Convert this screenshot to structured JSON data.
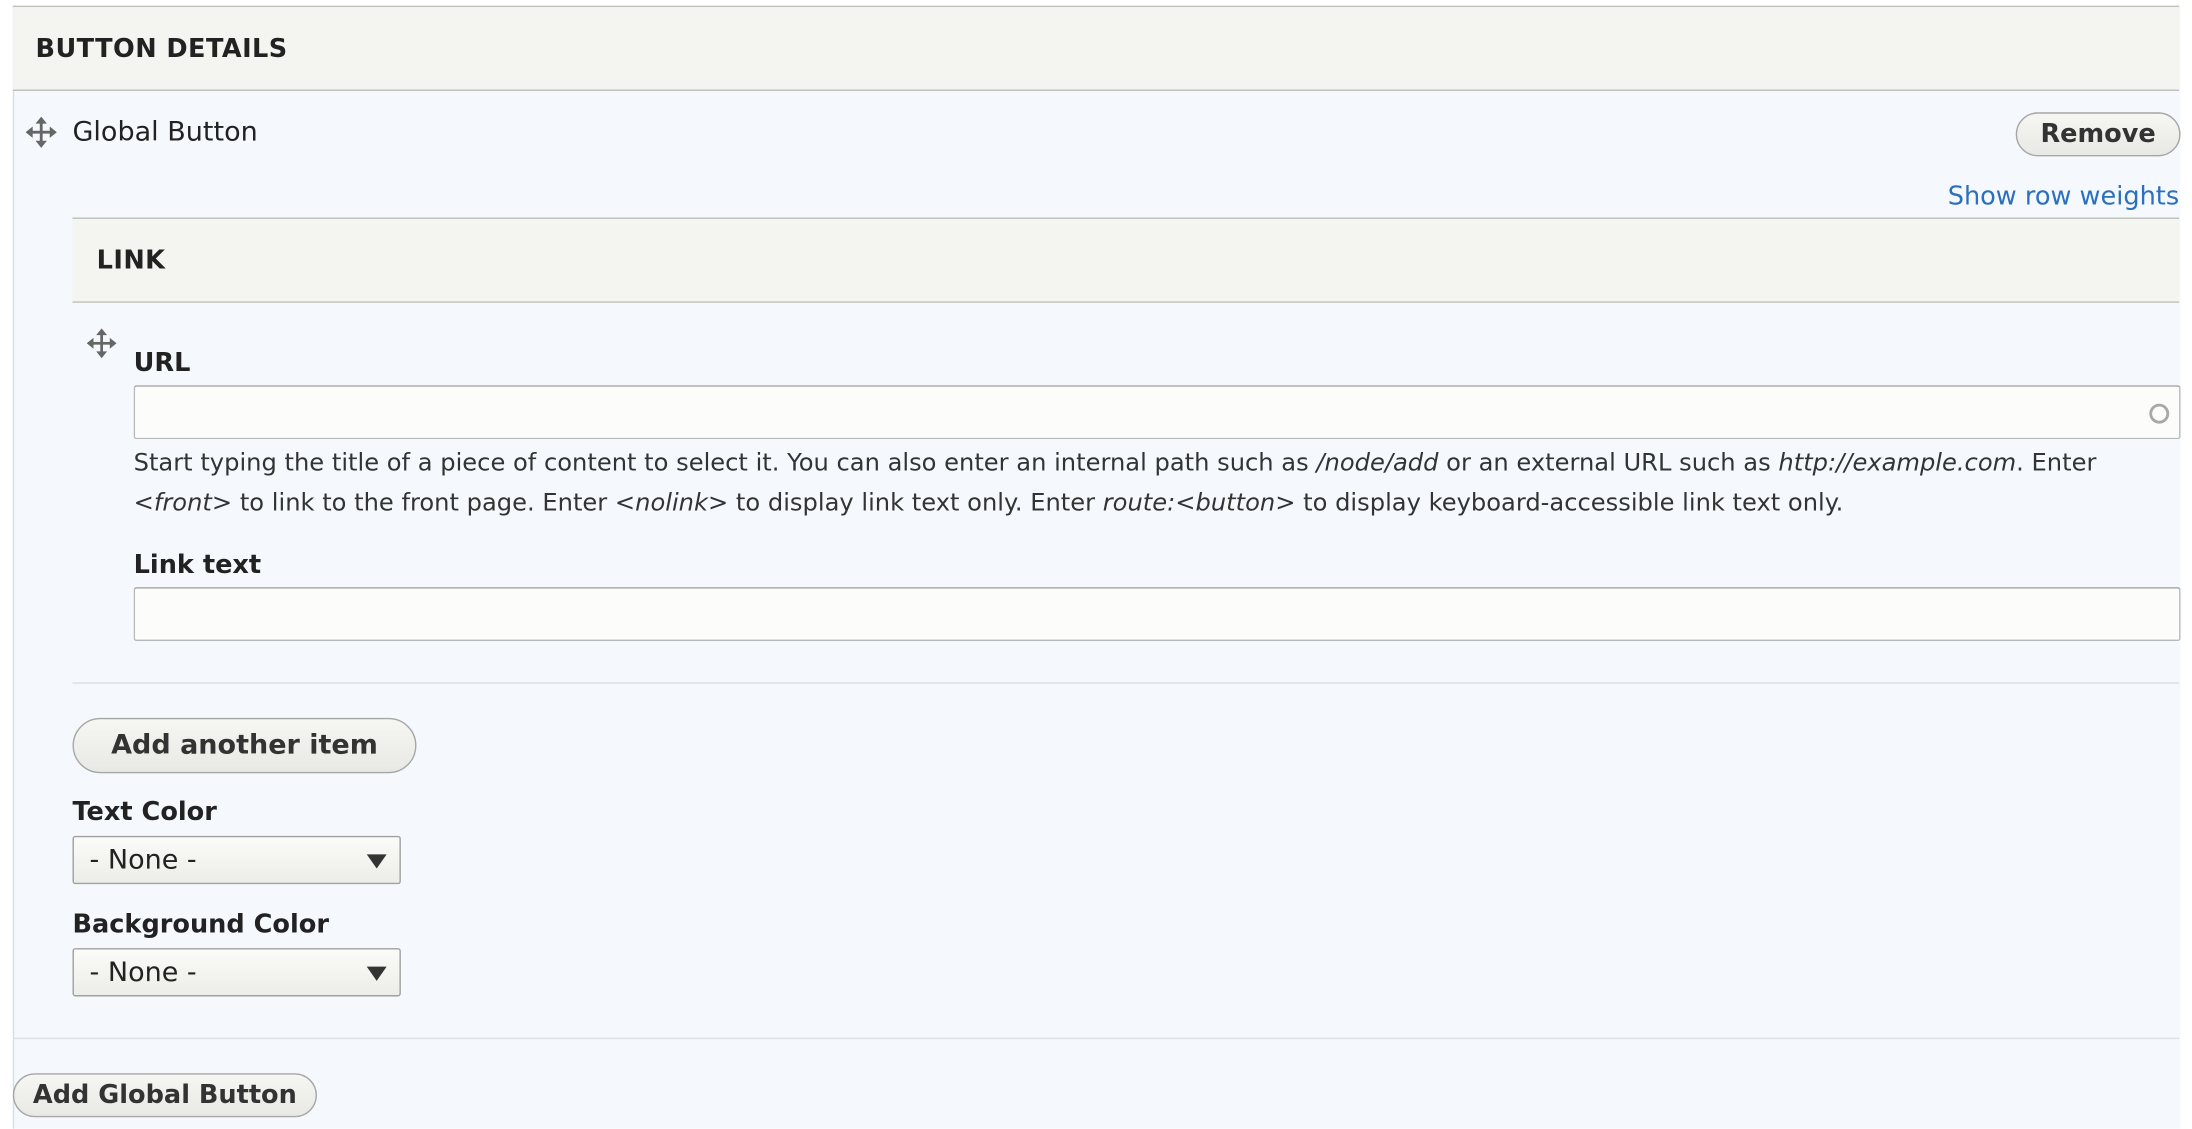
{
  "button_details": {
    "section_title": "BUTTON DETAILS",
    "item_label": "Global Button",
    "remove_label": "Remove",
    "show_row_weights": "Show row weights",
    "add_global_button_label": "Add Global Button"
  },
  "link": {
    "section_title": "LINK",
    "url": {
      "label": "URL",
      "value": "",
      "description": {
        "part1": "Start typing the title of a piece of content to select it. You can also enter an internal path such as ",
        "path_example": "/node/add",
        "part2": " or an external URL such as ",
        "url_example": "http://example.com",
        "part3": ". Enter",
        "front": "<front>",
        "part4": " to link to the front page. Enter ",
        "nolink": "<nolink>",
        "part5": " to display link text only. Enter ",
        "route_button": "route:<button>",
        "part6": " to display keyboard-accessible link text only."
      }
    },
    "link_text": {
      "label": "Link text",
      "value": ""
    },
    "add_another_item_label": "Add another item"
  },
  "text_color": {
    "label": "Text Color",
    "selected": "- None -"
  },
  "background_color": {
    "label": "Background Color",
    "selected": "- None -"
  },
  "colors": {
    "link": "#2b6fbd",
    "panel_background": "#f5f9fd",
    "header_background": "#f4f4f1"
  },
  "icons": {
    "row_drag": "move-arrows-icon",
    "link_drag": "move-arrows-icon",
    "url_autocomplete": "autocomplete-throbber-icon",
    "select_arrow": "triangle-down-icon"
  }
}
